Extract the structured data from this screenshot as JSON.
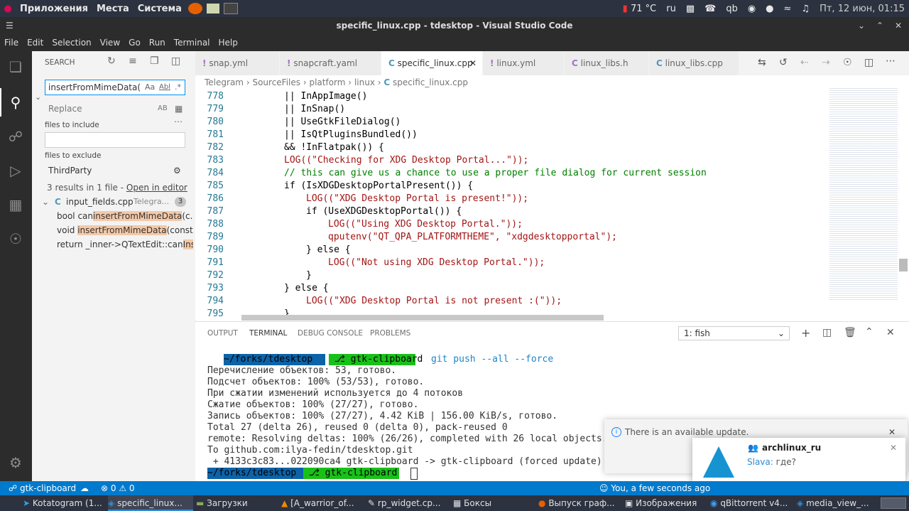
{
  "system_panel": {
    "apps_label": "Приложения",
    "places_label": "Места",
    "system_label": "Система",
    "temperature": "71 °C",
    "keyboard_layout": "ru",
    "clock": "Пт, 12 июн, 01:15"
  },
  "window": {
    "title": "specific_linux.cpp - tdesktop - Visual Studio Code"
  },
  "menu": [
    "File",
    "Edit",
    "Selection",
    "View",
    "Go",
    "Run",
    "Terminal",
    "Help"
  ],
  "sidebar": {
    "title": "SEARCH",
    "search_value": "insertFromMimeData(",
    "opt_case": "Aa",
    "opt_word": "Abl",
    "opt_regex": ".*",
    "replace_placeholder": "Replace",
    "replace_opt": "AB",
    "files_include_label": "files to include",
    "files_include_value": "",
    "files_exclude_label": "files to exclude",
    "files_exclude_value": "ThirdParty",
    "summary_text": "3 results in 1 file - ",
    "summary_link": "Open in editor",
    "file_name": "input_fields.cpp",
    "file_path": "Telegra...",
    "file_count": "3",
    "results": [
      {
        "pre": "bool can",
        "match": "insertFromMimeData",
        "post": "(c..."
      },
      {
        "pre": "void ",
        "match": "insertFromMimeData",
        "post": "(const ..."
      },
      {
        "pre": "return _inner->QTextEdit::can",
        "match": "Ins...",
        "post": ""
      }
    ]
  },
  "tabs": [
    {
      "label": "snap.yml",
      "icon": "!"
    },
    {
      "label": "snapcraft.yaml",
      "icon": "!"
    },
    {
      "label": "specific_linux.cpp",
      "icon": "C",
      "active": true
    },
    {
      "label": "linux.yml",
      "icon": "!"
    },
    {
      "label": "linux_libs.h",
      "icon": "C"
    },
    {
      "label": "linux_libs.cpp",
      "icon": "C"
    }
  ],
  "breadcrumb": [
    "Telegram",
    "SourceFiles",
    "platform",
    "linux",
    "specific_linux.cpp"
  ],
  "editor": {
    "lines": [
      {
        "n": "778",
        "text": "|| InAppImage()"
      },
      {
        "n": "779",
        "text": "|| InSnap()"
      },
      {
        "n": "780",
        "text": "|| UseGtkFileDialog()"
      },
      {
        "n": "781",
        "text": "|| IsQtPluginsBundled())"
      },
      {
        "n": "782",
        "text": "&& !InFlatpak()) {"
      },
      {
        "n": "783",
        "text": "LOG((\"Checking for XDG Desktop Portal...\"));"
      },
      {
        "n": "784",
        "text": "// this can give us a chance to use a proper file dialog for current session"
      },
      {
        "n": "785",
        "text": "if (IsXDGDesktopPortalPresent()) {"
      },
      {
        "n": "786",
        "text": "LOG((\"XDG Desktop Portal is present!\"));"
      },
      {
        "n": "787",
        "text": "if (UseXDGDesktopPortal()) {"
      },
      {
        "n": "788",
        "text": "LOG((\"Using XDG Desktop Portal.\"));"
      },
      {
        "n": "789",
        "text": "qputenv(\"QT_QPA_PLATFORMTHEME\", \"xdgdesktopportal\");"
      },
      {
        "n": "790",
        "text": "} else {"
      },
      {
        "n": "791",
        "text": "LOG((\"Not using XDG Desktop Portal.\"));"
      },
      {
        "n": "792",
        "text": "}"
      },
      {
        "n": "793",
        "text": "} else {"
      },
      {
        "n": "794",
        "text": "LOG((\"XDG Desktop Portal is not present :(\"));"
      },
      {
        "n": "795",
        "text": "}"
      }
    ]
  },
  "panel": {
    "tabs": [
      "OUTPUT",
      "TERMINAL",
      "DEBUG CONSOLE",
      "PROBLEMS"
    ],
    "active_tab": "TERMINAL",
    "terminal_select": "1: fish",
    "prompt_path": "~/forks/tdesktop",
    "prompt_branch": "gtk-clipboard",
    "command": "git push --all --force",
    "output": [
      "Перечисление объектов: 53, готово.",
      "Подсчет объектов: 100% (53/53), готово.",
      "При сжатии изменений используется до 4 потоков",
      "Сжатие объектов: 100% (27/27), готово.",
      "Запись объектов: 100% (27/27), 4.42 KiB | 156.00 KiB/s, готово.",
      "Total 27 (delta 26), reused 0 (delta 0), pack-reused 0",
      "remote: Resolving deltas: 100% (26/26), completed with 26 local objects.",
      "To github.com:ilya-fedin/tdesktop.git",
      " + 4133c3c83...022090ca4 gtk-clipboard -> gtk-clipboard (forced update)"
    ]
  },
  "notifications": {
    "update_text": "There is an available update.",
    "chat_title": "archlinux_ru",
    "chat_sender": "Slava:",
    "chat_message": " где?"
  },
  "statusbar": {
    "branch": "gtk-clipboard",
    "problems": "⊗ 0 ⚠ 0",
    "right_text": "You, a few seconds ago"
  },
  "taskbar": [
    {
      "label": "Kotatogram (1..."
    },
    {
      "label": "specific_linux...",
      "active": true
    },
    {
      "label": "Загрузки"
    },
    {
      "label": "[A_warrior_of..."
    },
    {
      "label": "rp_widget.cp..."
    },
    {
      "label": "Боксы"
    },
    {
      "label": "Выпуск граф..."
    },
    {
      "label": "Изображения"
    },
    {
      "label": "qBittorrent v4..."
    },
    {
      "label": "media_view_..."
    }
  ]
}
